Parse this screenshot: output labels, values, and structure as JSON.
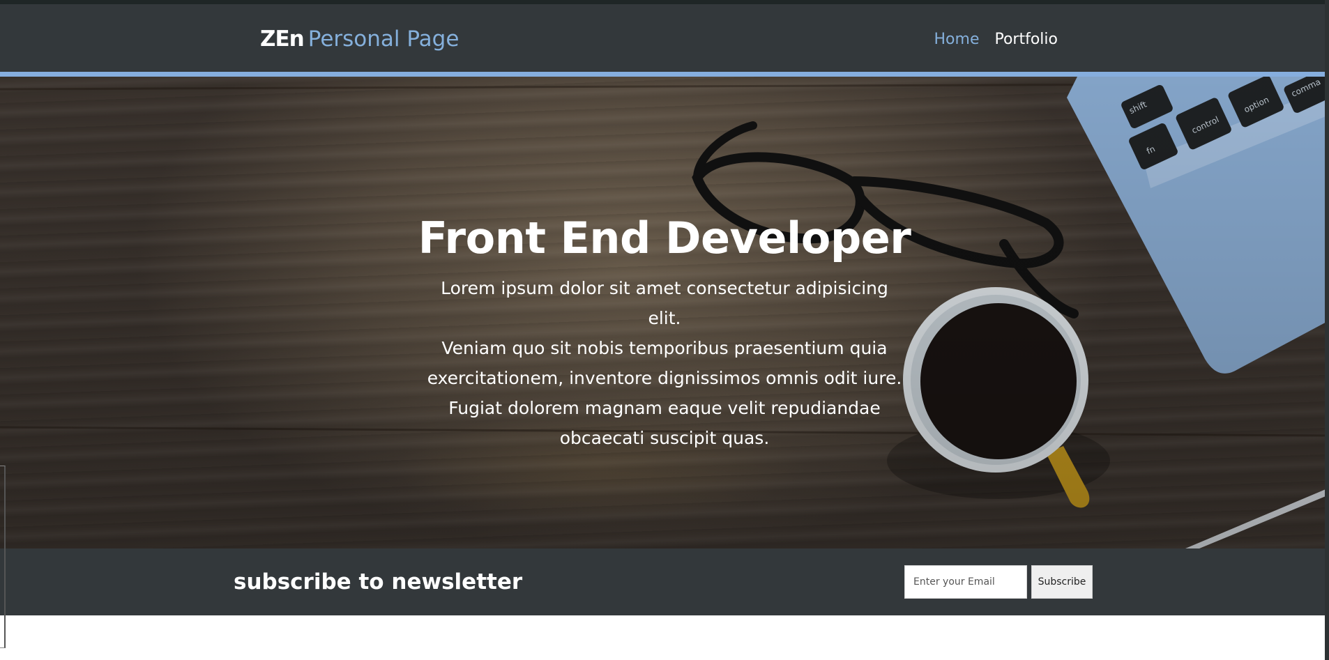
{
  "brand": {
    "bold": "ZEn",
    "light": "Personal Page"
  },
  "nav": {
    "items": [
      {
        "label": "Home",
        "active": true
      },
      {
        "label": "Portfolio",
        "active": false
      }
    ]
  },
  "hero": {
    "title": "Front End Developer",
    "text_lines": [
      "Lorem ipsum dolor sit amet consectetur adipisicing elit.",
      "Veniam quo sit nobis temporibus praesentium quia",
      "exercitationem, inventore dignissimos omnis odit iure.",
      "Fugiat dolorem magnam eaque velit repudiandae",
      "obcaecati suscipit quas."
    ],
    "keyboard_keys": [
      "shift",
      "fn",
      "control",
      "option",
      "comma"
    ]
  },
  "newsletter": {
    "title": "subscribe to newsletter",
    "email_placeholder": "Enter your Email",
    "button_label": "Subscribe"
  },
  "colors": {
    "navbar": "#33383b",
    "accent": "#85b0dc",
    "newsletter": "#33383b"
  }
}
